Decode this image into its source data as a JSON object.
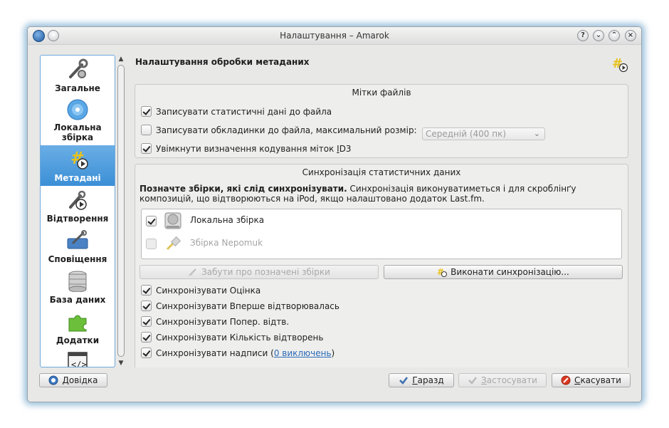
{
  "window": {
    "title": "Налаштування – Amarok"
  },
  "titlebar": {
    "help": "?",
    "minimize": "⌄",
    "maximize": "⌃",
    "close": "×"
  },
  "sidebar": {
    "items": [
      {
        "label": "Загальне",
        "icon": "wrench-icon"
      },
      {
        "label": "Локальна збірка",
        "icon": "cd-icon"
      },
      {
        "label": "Метадані",
        "icon": "tag-icon",
        "active": true
      },
      {
        "label": "Відтворення",
        "icon": "playback-icon"
      },
      {
        "label": "Сповіщення",
        "icon": "notification-icon"
      },
      {
        "label": "База даних",
        "icon": "database-icon"
      },
      {
        "label": "Додатки",
        "icon": "puzzle-icon"
      }
    ]
  },
  "page": {
    "title": "Налаштування обробки метаданих"
  },
  "file_tags": {
    "title": "Мітки файлів",
    "write_stats": {
      "label": "Записувати статистичні дані до файла",
      "checked": true
    },
    "write_covers": {
      "label": "Записувати обкладинки до файла, максимальний розмір:",
      "checked": false
    },
    "cover_size": "Середній (400 пк)",
    "id3_encoding": {
      "label_prefix": "Увімкнути визначення кодування міток ",
      "mnemonic": "I",
      "label_suffix": "D3",
      "checked": true
    }
  },
  "sync": {
    "title": "Синхронізація статистичних даних",
    "intro_bold": "Позначте збірки, які слід синхронізувати.",
    "intro_text": " Синхронізація виконуватиметься і для скроблінґу композицій, що відтворюються на iPod, якщо налаштовано додаток Last.fm.",
    "collections": [
      {
        "label": "Локальна збірка",
        "checked": true,
        "enabled": true
      },
      {
        "label": "Збірка Nepomuk",
        "checked": false,
        "enabled": false
      }
    ],
    "forget_button": "Забути про позначені збірки",
    "sync_button": "Виконати синхронізацію...",
    "options": [
      {
        "label": "Синхронізувати Оцінка",
        "checked": true
      },
      {
        "label": "Синхронізувати Вперше відтворювалась",
        "checked": true
      },
      {
        "label": "Синхронізувати Попер. відтв.",
        "checked": true
      },
      {
        "label": "Синхронізувати Кількість відтворень",
        "checked": true
      }
    ],
    "labels_option": {
      "prefix": "Синхронізувати надписи (",
      "link": "0 виключень",
      "suffix": ")",
      "checked": true
    }
  },
  "footer": {
    "help": {
      "mnemonic": "Д",
      "rest": "овідка"
    },
    "ok": {
      "mnemonic": "Г",
      "rest": "аразд"
    },
    "apply": {
      "mnemonic": "З",
      "rest": "астосувати"
    },
    "cancel": {
      "mnemonic": "С",
      "rest": "касувати"
    }
  }
}
